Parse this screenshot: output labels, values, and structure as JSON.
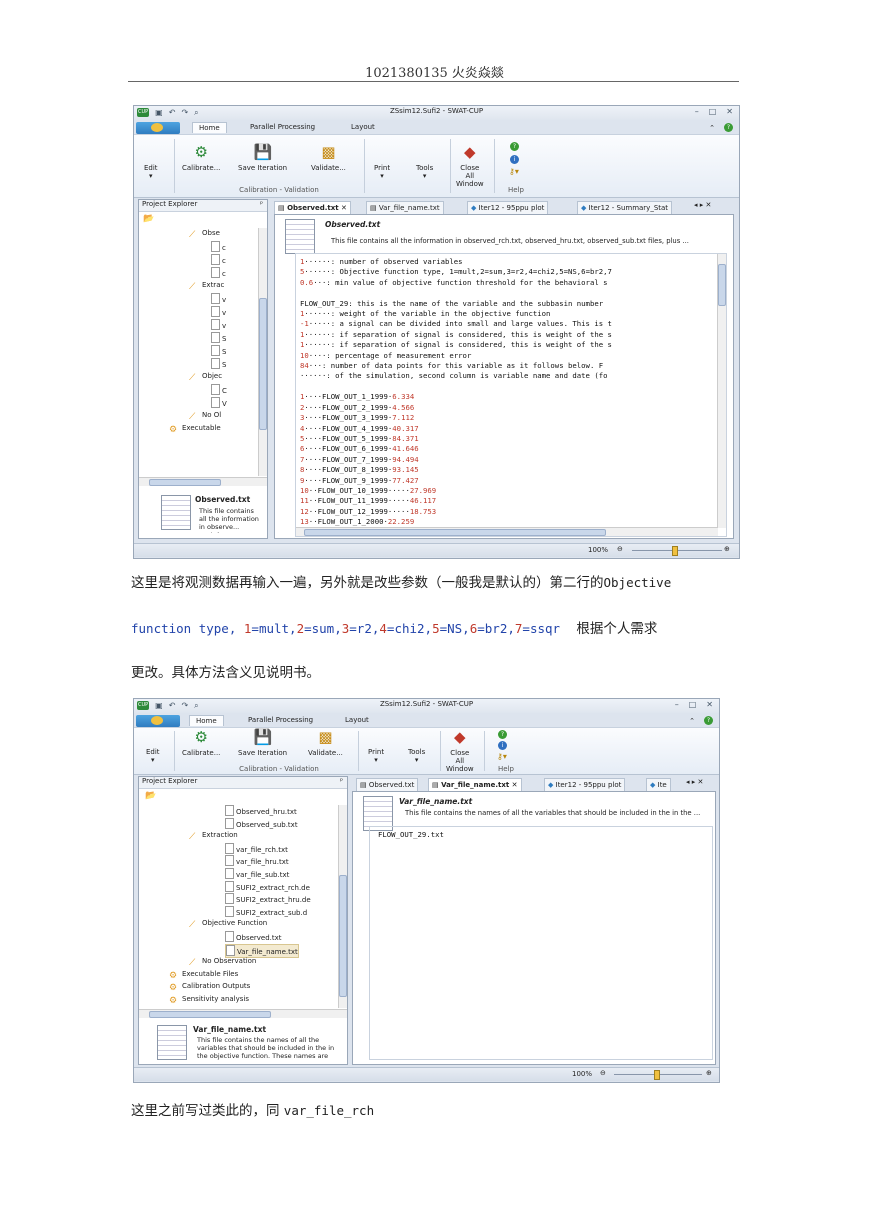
{
  "header": {
    "text": "1021380135 火炎焱燚"
  },
  "window": {
    "title": "ZSsim12.Sufi2 - SWAT-CUP",
    "tabs": [
      "Home",
      "Parallel Processing",
      "Layout"
    ],
    "ribbon": {
      "edit": "Edit",
      "calibrate": "Calibrate...",
      "save_iteration": "Save Iteration",
      "validate": "Validate...",
      "print": "Print",
      "tools": "Tools",
      "close_all": "Close All Window",
      "close_all_lines": [
        "Close",
        "All",
        "Window"
      ],
      "group_calibration": "Calibration - Validation",
      "group_help": "Help",
      "dropdown_glyph": "▾"
    },
    "explorer_title": "Project Explorer",
    "pin_glyph": "ᵖ",
    "zoom": "100%",
    "colors": {
      "accent": "#2f7cc0",
      "numbers": "#c0392b"
    }
  },
  "shot1": {
    "tree": [
      "Obse",
      "c",
      "c",
      "c",
      "Extrac",
      "v",
      "v",
      "v",
      "S",
      "S",
      "S",
      "Objec",
      "C",
      "V",
      "No Ol",
      "Executable"
    ],
    "doc_tabs": [
      "Observed.txt",
      "Var_file_name.txt",
      "Iter12 - 95ppu plot",
      "Iter12 - Summary_Stat"
    ],
    "file_title": "Observed.txt",
    "file_desc": "This file contains all the information in observed_rch.txt, observed_hru.txt, observed_sub.txt files, plus ...",
    "info_title": "Observed.txt",
    "info_text": "This file contains all the information in observe... contain",
    "code_lines": [
      "1······: number of observed variables",
      "5······: Objective function type, 1=mult,2=sum,3=r2,4=chi2,5=NS,6=br2,7",
      "0.6···: min value of objective function threshold for the behavioral s",
      "",
      "FLOW_OUT_29: this is the name of the variable and the subbasin number",
      "1······: weight of the variable in the objective function",
      "-1·····: a signal can be divided into small and large values. This is t",
      "1······: if separation of signal is considered, this is weight of the s",
      "1······: if separation of signal is considered, this is weight of the s",
      "10····: percentage of measurement error",
      "84···: number of data points for this variable as it follows below. F",
      "······: of the simulation, second column is variable name and date (fo",
      "",
      "1····FLOW_OUT_1_1999·6.334",
      "2····FLOW_OUT_2_1999·4.566",
      "3····FLOW_OUT_3_1999·7.112",
      "4····FLOW_OUT_4_1999·40.317",
      "5····FLOW_OUT_5_1999·84.371",
      "6····FLOW_OUT_6_1999·41.646",
      "7····FLOW_OUT_7_1999·94.494",
      "8····FLOW_OUT_8_1999·93.145",
      "9····FLOW_OUT_9_1999·77.427",
      "10··FLOW_OUT_10_1999·····27.969",
      "11··FLOW_OUT_11_1999·····46.117",
      "12··FLOW_OUT_12_1999·····18.753",
      "13··FLOW_OUT_1_2000·22.259"
    ]
  },
  "paragraph1": {
    "line1_prefix": "这里是将观测数据再输入一遍，另外就是改些参数（一般我是默认的）第二行的",
    "line1_code": "Objective",
    "line2_code_a": "function type, ",
    "n1": "1",
    "t1": "=mult,",
    "n2": "2",
    "t2": "=sum,",
    "n3": "3",
    "t3": "=r2,",
    "n4": "4",
    "t4": "=chi2,",
    "n5": "5",
    "t5": "=NS,",
    "n6": "6",
    "t6": "=br2,",
    "n7": "7",
    "t7": "=ssqr",
    "line2_tail": "根据个人需求",
    "line3": "更改。具体方法含义见说明书。"
  },
  "shot2": {
    "tree": [
      {
        "label": "Observed_hru.txt",
        "type": "file"
      },
      {
        "label": "Observed_sub.txt",
        "type": "file"
      },
      {
        "label": "Extraction",
        "type": "folder"
      },
      {
        "label": "var_file_rch.txt",
        "type": "file"
      },
      {
        "label": "var_file_hru.txt",
        "type": "file"
      },
      {
        "label": "var_file_sub.txt",
        "type": "file"
      },
      {
        "label": "SUFI2_extract_rch.de",
        "type": "file"
      },
      {
        "label": "SUFI2_extract_hru.de",
        "type": "file"
      },
      {
        "label": "SUFI2_extract_sub.d",
        "type": "file"
      },
      {
        "label": "Objective Function",
        "type": "folder"
      },
      {
        "label": "Observed.txt",
        "type": "file"
      },
      {
        "label": "Var_file_name.txt",
        "type": "file"
      },
      {
        "label": "No Observation",
        "type": "folder"
      },
      {
        "label": "Executable Files",
        "type": "exec"
      },
      {
        "label": "Calibration Outputs",
        "type": "exec"
      },
      {
        "label": "Sensitivity analysis",
        "type": "exec"
      }
    ],
    "doc_tabs": [
      "Observed.txt",
      "Var_file_name.txt",
      "Iter12 - 95ppu plot",
      "Ite"
    ],
    "file_title": "Var_file_name.txt",
    "file_desc": "This file contains the names of all the variables that should be included in the in the ...",
    "info_title": "Var_file_name.txt",
    "info_text": "This file contains the names of all the variables that should be included in the in the objective function. These names are similar to the names in the",
    "code_line": "FLOW_OUT_29.txt"
  },
  "paragraph2": {
    "prefix": "这里之前写过类此的，同 ",
    "code": "var_file_rch"
  }
}
